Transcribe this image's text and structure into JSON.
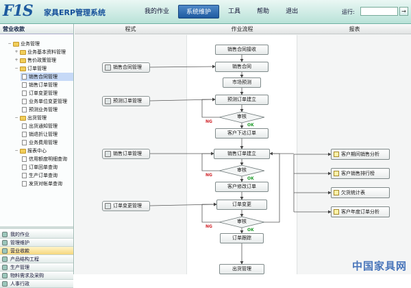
{
  "header": {
    "logo": "F1S",
    "title": "家具ERP管理系统",
    "nav": [
      "我的作业",
      "系统维护",
      "工具",
      "帮助",
      "退出"
    ],
    "active_nav": 1,
    "run_label": "运行:",
    "run_value": "",
    "run_go": "→"
  },
  "sidebar": {
    "title": "营业收款",
    "tree": [
      {
        "label": "业务管理",
        "type": "folder",
        "level": 0,
        "exp": "-"
      },
      {
        "label": "业务基本资料管理",
        "type": "folder",
        "level": 1,
        "exp": "+"
      },
      {
        "label": "售价政策管理",
        "type": "folder",
        "level": 1,
        "exp": "+"
      },
      {
        "label": "订单管理",
        "type": "folder",
        "level": 1,
        "exp": "-"
      },
      {
        "label": "销售合同管理",
        "type": "doc",
        "level": 2,
        "selected": true
      },
      {
        "label": "销售订单管理",
        "type": "doc",
        "level": 2
      },
      {
        "label": "订单变更管理",
        "type": "doc",
        "level": 2
      },
      {
        "label": "业务单位变更管理",
        "type": "doc",
        "level": 2
      },
      {
        "label": "预测业务管理",
        "type": "doc",
        "level": 2
      },
      {
        "label": "出货管理",
        "type": "folder",
        "level": 1,
        "exp": "-"
      },
      {
        "label": "出货通知管理",
        "type": "doc",
        "level": 2
      },
      {
        "label": "销退折让管理",
        "type": "doc",
        "level": 2
      },
      {
        "label": "业务费用管理",
        "type": "doc",
        "level": 2
      },
      {
        "label": "报表中心",
        "type": "folder",
        "level": 1,
        "exp": "-"
      },
      {
        "label": "信用额度明细查询",
        "type": "doc",
        "level": 2
      },
      {
        "label": "订单回单查询",
        "type": "doc",
        "level": 2
      },
      {
        "label": "生产订单查询",
        "type": "doc",
        "level": 2
      },
      {
        "label": "发货对帐单查询",
        "type": "doc",
        "level": 2
      }
    ],
    "modules": [
      {
        "label": "我的作业"
      },
      {
        "label": "管理维护"
      },
      {
        "label": "营业收款",
        "active": true
      },
      {
        "label": "产品结构工程"
      },
      {
        "label": "生产管理"
      },
      {
        "label": "物料需求及采购"
      },
      {
        "label": "人事行政"
      }
    ]
  },
  "main": {
    "columns": [
      "程式",
      "作业流程",
      "报表"
    ],
    "programs": [
      "销售合同管理",
      "预测订单管理",
      "销售订单管理",
      "订单变更管理"
    ],
    "flow": [
      "销售合同接收",
      "销售合同",
      "市场预测",
      "预测订单建立",
      "审核",
      "客户下达订单",
      "销售订单建立",
      "审核",
      "客户修改订单",
      "订单变更",
      "审核",
      "订单跟踪",
      "出货管理"
    ],
    "reports": [
      "客户期间销售分析",
      "客户销售排行榜",
      "欠货统计表",
      "客户年度订单分析"
    ],
    "ok_label": "OK",
    "ng_label": "NG"
  },
  "colors": {
    "header_active": "#1e5aa0",
    "ok": "#1f9a2a",
    "ng": "#d0242a",
    "selected_row": "#c6d9f7"
  },
  "watermark": "中国家具网"
}
